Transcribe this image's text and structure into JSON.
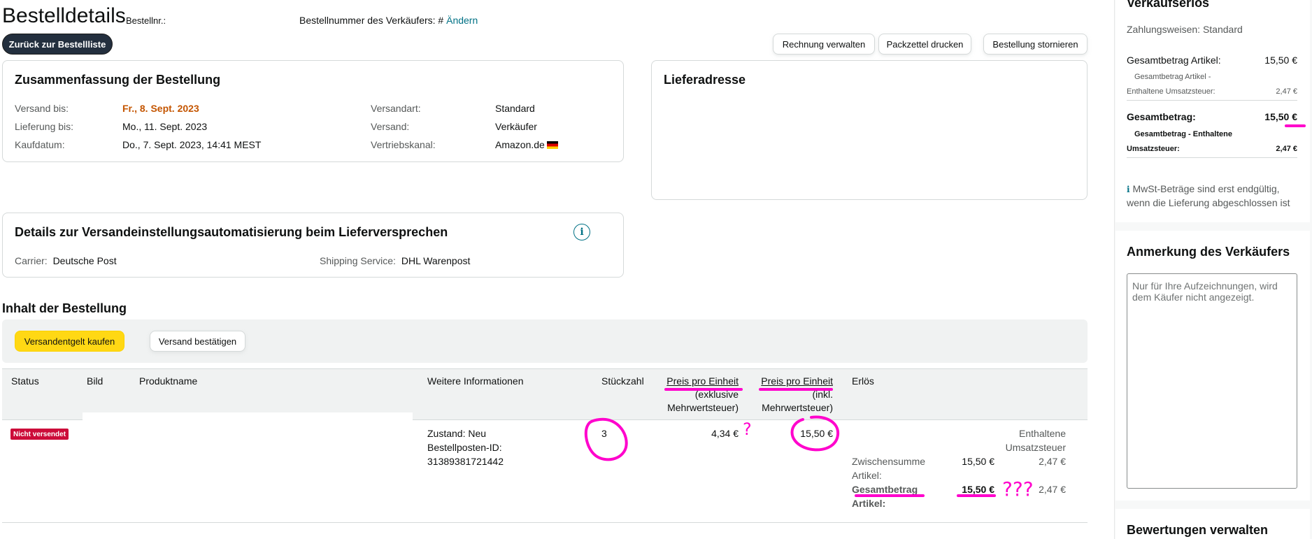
{
  "header": {
    "title": "Bestelldetails",
    "order_no_label": "Bestellnr.:",
    "seller_order_label": "Bestellnummer des Verkäufers: #",
    "change_link": "Ändern",
    "back_button": "Zurück zur Bestellliste",
    "actions": {
      "invoice": "Rechnung verwalten",
      "packing_slip": "Packzettel drucken",
      "cancel": "Bestellung stornieren"
    }
  },
  "summary": {
    "title": "Zusammenfassung der Bestellung",
    "ship_by_label": "Versand bis:",
    "ship_by_value": "Fr., 8. Sept. 2023",
    "deliver_by_label": "Lieferung bis:",
    "deliver_by_value": "Mo., 11. Sept. 2023",
    "purchase_date_label": "Kaufdatum:",
    "purchase_date_value": "Do., 7. Sept. 2023, 14:41 MEST",
    "shipping_method_label": "Versandart:",
    "shipping_method_value": "Standard",
    "fulfillment_label": "Versand:",
    "fulfillment_value": "Verkäufer",
    "channel_label": "Vertriebskanal:",
    "channel_value": "Amazon.de"
  },
  "address": {
    "title": "Lieferadresse"
  },
  "automation": {
    "title": "Details zur Versandeinstellungsautomatisierung beim Lieferversprechen",
    "carrier_label": "Carrier:",
    "carrier_value": "Deutsche Post",
    "service_label": "Shipping Service:",
    "service_value": "DHL Warenpost"
  },
  "contents": {
    "title": "Inhalt der Bestellung",
    "buy_shipping_button": "Versandentgelt kaufen",
    "confirm_shipping_button": "Versand bestätigen",
    "columns": {
      "status": "Status",
      "image": "Bild",
      "product": "Produktname",
      "more_info": "Weitere Informationen",
      "quantity": "Stückzahl",
      "unit_price_ex_1": "Preis pro Einheit",
      "unit_price_ex_2": "(exklusive",
      "unit_price_ex_3": "Mehrwertsteuer)",
      "unit_price_inc_1": "Preis pro Einheit",
      "unit_price_inc_2": "(inkl.",
      "unit_price_inc_3": "Mehrwertsteuer)",
      "proceeds": "Erlös"
    },
    "row": {
      "status_badge": "Nicht versendet",
      "condition": "Zustand: Neu",
      "item_id_label": "Bestellposten-ID:",
      "item_id_value": "31389381721442",
      "quantity": "3",
      "unit_price_ex": "4,34 €",
      "unit_price_inc": "15,50 €",
      "tax_header_1": "Enthaltene",
      "tax_header_2": "Umsatzsteuer",
      "subtotal_label_1": "Zwischensumme",
      "subtotal_label_2": "Artikel:",
      "subtotal_value": "15,50 €",
      "subtotal_tax": "2,47 €",
      "total_label_1": "Gesamtbetrag",
      "total_label_2": "Artikel:",
      "total_value": "15,50 €",
      "total_tax": "2,47 €"
    }
  },
  "sidebar": {
    "proceeds_title": "Verkaufserlös",
    "payment_methods": "Zahlungsweisen: Standard",
    "items_total_label": "Gesamtbetrag Artikel:",
    "items_total_value": "15,50 €",
    "items_tax_label_1": "Gesamtbetrag Artikel -",
    "items_tax_label_2": "Enthaltene Umsatzsteuer:",
    "items_tax_value": "2,47 €",
    "grand_total_label": "Gesamtbetrag:",
    "grand_total_value": "15,50 €",
    "grand_tax_label_1": "Gesamtbetrag - Enthaltene",
    "grand_tax_label_2": "Umsatzsteuer:",
    "grand_tax_value": "2,47 €",
    "vat_note_icon": "i",
    "vat_note_1": "MwSt-Beträge sind erst endgültig,",
    "vat_note_2": "wenn die Lieferung abgeschlossen ist",
    "seller_note_title": "Anmerkung des Verkäufers",
    "seller_note_placeholder": "Nur für Ihre Aufzeichnungen, wird dem Käufer nicht angezeigt.",
    "reviews_title": "Bewertungen verwalten"
  },
  "annotations": {
    "q1": "?",
    "q3": "???",
    "color": "#ff00cc"
  }
}
